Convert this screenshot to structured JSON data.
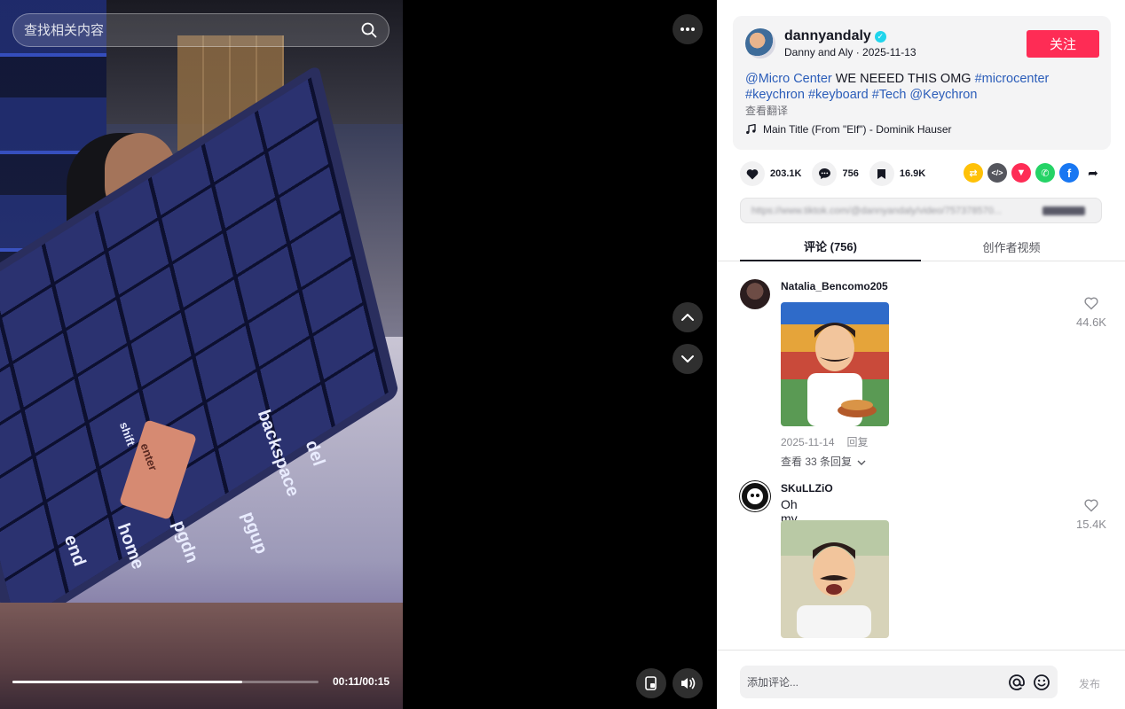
{
  "search": {
    "placeholder": "查找相关内容"
  },
  "player": {
    "progress_fraction": 0.75,
    "time_label": "00:11/00:15",
    "keycaps": [
      "backspace",
      "del",
      "pgup",
      "pgdn",
      "home",
      "end",
      "enter",
      "shift"
    ]
  },
  "post": {
    "author": "dannyandaly",
    "author_sub": "Danny and Aly · 2025-11-13",
    "follow_label": "关注",
    "caption": {
      "mention_1": "@Micro Center",
      "text_1": " WE NEEED THIS OMG ",
      "tag_1": "#microcenter",
      "tag_2": "#keychron",
      "tag_3": "#keyboard",
      "tag_4": "#Tech",
      "mention_2": "@Keychron"
    },
    "translate_label": "查看翻译",
    "music": "Main Title (From \"Elf\") - Dominik Hauser"
  },
  "actions": {
    "likes": "203.1K",
    "comments": "756",
    "saves": "16.9K"
  },
  "share": {
    "link_text": "https://www.tiktok.com/@dannyandaly/video/757378570..."
  },
  "tabs": {
    "comments_label": "评论 (756)",
    "creator_videos_label": "创作者视频"
  },
  "comments": [
    {
      "user": "Natalia_Bencomo205",
      "text": "",
      "date": "2025-11-14",
      "reply_label": "回复",
      "view_replies": "查看 33 条回复",
      "likes": "44.6K"
    },
    {
      "user": "SKuLLZiO",
      "text": "Oh my god",
      "likes": "15.4K"
    }
  ],
  "composer": {
    "placeholder": "添加评论...",
    "post_label": "发布"
  },
  "colors": {
    "brand_red": "#fe2c55",
    "link_blue": "#2b5db9",
    "verified": "#20d5ec"
  }
}
